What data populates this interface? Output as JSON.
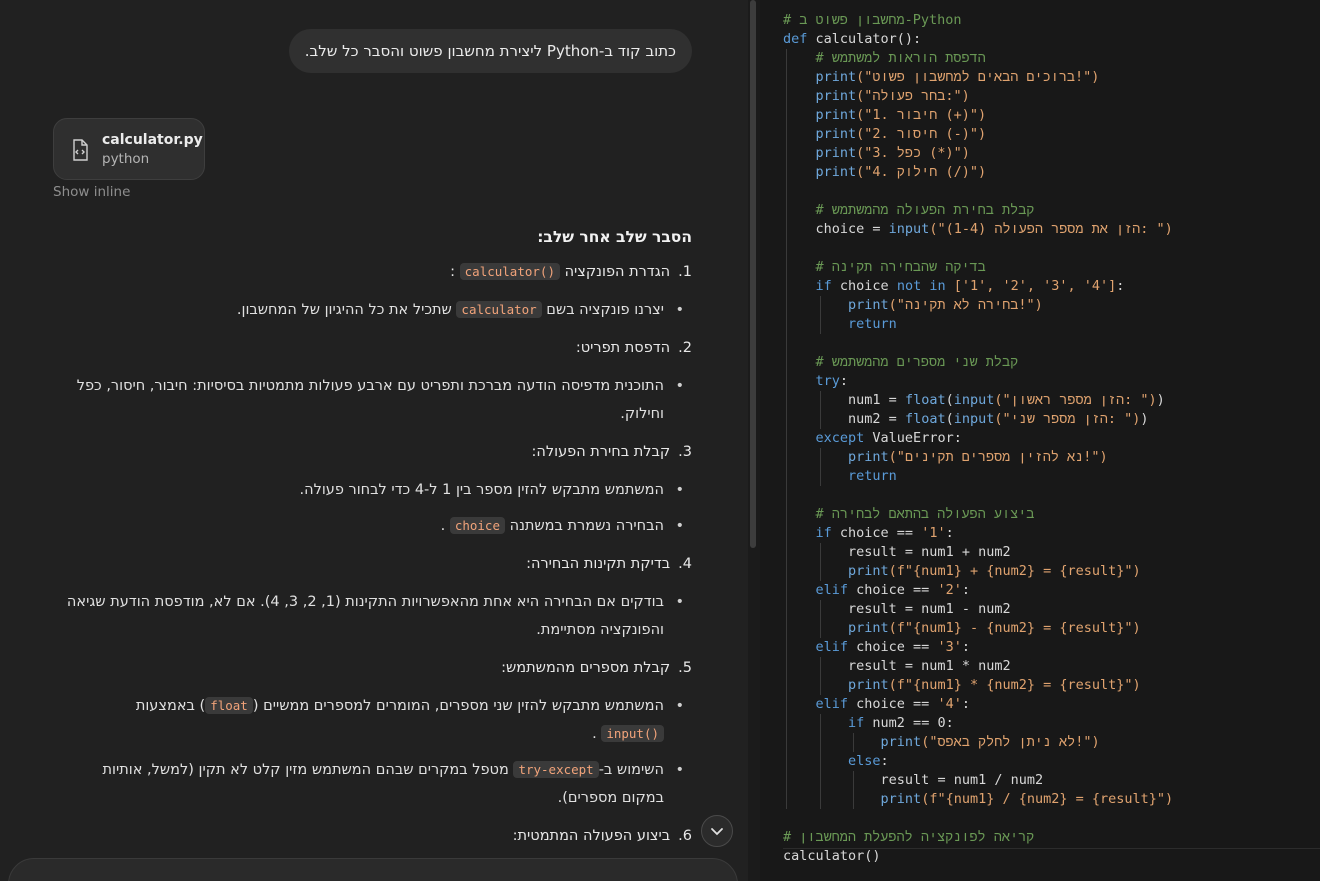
{
  "chat": {
    "user_message": "כתוב קוד ב-Python ליצירת מחשבון פשוט והסבר כל שלב.",
    "file_card": {
      "name": "calculator.py",
      "type": "python",
      "icon": "code-file-icon"
    },
    "show_inline": "Show inline",
    "title": "הסבר שלב אחר שלב:",
    "steps": [
      {
        "num": "1.",
        "label": "הגדרת הפונקציה",
        "code": "calculator()",
        "suffix": ":"
      },
      {
        "num": "2.",
        "label": "הדפסת תפריט:"
      },
      {
        "num": "3.",
        "label": "קבלת בחירת הפעולה:"
      },
      {
        "num": "4.",
        "label": "בדיקת תקינות הבחירה:"
      },
      {
        "num": "5.",
        "label": "קבלת מספרים מהמשתמש:"
      },
      {
        "num": "6.",
        "label": "ביצוע הפעולה המתמטית:"
      }
    ],
    "bullets": {
      "b1_pre": "יצרנו פונקציה בשם",
      "b1_code": "calculator",
      "b1_post": "שתכיל את כל ההיגיון של המחשבון.",
      "b2_line1": "התוכנית מדפיסה הודעה מברכת ותפריט עם ארבע פעולות מתמטיות בסיסיות: חיבור, חיסור, כפל",
      "b2_line2": "וחילוק.",
      "b3": "המשתמש מתבקש להזין מספר בין 1 ל-4 כדי לבחור פעולה.",
      "b4_pre": "הבחירה נשמרת במשתנה",
      "b4_code": "choice",
      "b4_post": ".",
      "b5_line1": "בודקים אם הבחירה היא אחת מהאפשרויות התקינות (1, 2, 3, 4). אם לא, מודפסת הודעת שגיאה",
      "b5_line2": "והפונקציה מסתיימת.",
      "b6_pre": "המשתמש מתבקש להזין שני מספרים, המומרים למספרים ממשיים (",
      "b6_code1": "float",
      "b6_mid": ") באמצעות",
      "b6_code2": "input()",
      "b6_post": ".",
      "b7_pre": "השימוש ב-",
      "b7_code": "try-except",
      "b7_post": "מטפל במקרים שבהם המשתמש מזין קלט לא תקין (למשל, אותיות",
      "b7_line2": "במקום מספרים)."
    }
  },
  "code": {
    "lines": [
      {
        "i": 0,
        "t": [
          [
            "cm",
            "# מחשבון פשוט ב-Python"
          ]
        ]
      },
      {
        "i": 0,
        "t": [
          [
            "kw",
            "def "
          ],
          [
            "nm",
            "calculator():"
          ]
        ]
      },
      {
        "i": 1,
        "t": [
          [
            "cm",
            "# הדפסת הוראות למשתמש"
          ]
        ]
      },
      {
        "i": 1,
        "t": [
          [
            "fn",
            "print"
          ],
          [
            "str",
            "(\"ברוכים הבאים למחשבון פשוט!\")"
          ]
        ]
      },
      {
        "i": 1,
        "t": [
          [
            "fn",
            "print"
          ],
          [
            "str",
            "(\"בחר פעולה:\")"
          ]
        ]
      },
      {
        "i": 1,
        "t": [
          [
            "fn",
            "print"
          ],
          [
            "str",
            "(\"1. חיבור (+)\")"
          ]
        ]
      },
      {
        "i": 1,
        "t": [
          [
            "fn",
            "print"
          ],
          [
            "str",
            "(\"2. חיסור (-)\")"
          ]
        ]
      },
      {
        "i": 1,
        "t": [
          [
            "fn",
            "print"
          ],
          [
            "str",
            "(\"3. כפל (*)\")"
          ]
        ]
      },
      {
        "i": 1,
        "t": [
          [
            "fn",
            "print"
          ],
          [
            "str",
            "(\"4. חילוק (/)\")"
          ]
        ]
      },
      {
        "i": 1,
        "t": []
      },
      {
        "i": 1,
        "t": [
          [
            "cm",
            "# קבלת בחירת הפעולה מהמשתמש"
          ]
        ]
      },
      {
        "i": 1,
        "t": [
          [
            "nm",
            "choice = "
          ],
          [
            "fn",
            "input"
          ],
          [
            "str",
            "(\"הזן את מספר הפעולה (1-4): \")"
          ]
        ]
      },
      {
        "i": 1,
        "t": []
      },
      {
        "i": 1,
        "t": [
          [
            "cm",
            "# בדיקה שהבחירה תקינה"
          ]
        ]
      },
      {
        "i": 1,
        "t": [
          [
            "kw",
            "if "
          ],
          [
            "nm",
            "choice "
          ],
          [
            "kw",
            "not in "
          ],
          [
            "str",
            "['1', '2', '3', '4']"
          ],
          [
            "nm",
            ":"
          ]
        ]
      },
      {
        "i": 2,
        "t": [
          [
            "fn",
            "print"
          ],
          [
            "str",
            "(\"בחירה לא תקינה!\")"
          ]
        ]
      },
      {
        "i": 2,
        "t": [
          [
            "kw",
            "return"
          ]
        ]
      },
      {
        "i": 1,
        "t": []
      },
      {
        "i": 1,
        "t": [
          [
            "cm",
            "# קבלת שני מספרים מהמשתמש"
          ]
        ]
      },
      {
        "i": 1,
        "t": [
          [
            "kw",
            "try"
          ],
          [
            "nm",
            ":"
          ]
        ]
      },
      {
        "i": 2,
        "t": [
          [
            "nm",
            "num1 = "
          ],
          [
            "fn",
            "float"
          ],
          [
            "nm",
            "("
          ],
          [
            "fn",
            "input"
          ],
          [
            "str",
            "(\"הזן מספר ראשון: \")"
          ],
          [
            "nm",
            ")"
          ]
        ]
      },
      {
        "i": 2,
        "t": [
          [
            "nm",
            "num2 = "
          ],
          [
            "fn",
            "float"
          ],
          [
            "nm",
            "("
          ],
          [
            "fn",
            "input"
          ],
          [
            "str",
            "(\"הזן מספר שני: \")"
          ],
          [
            "nm",
            ")"
          ]
        ]
      },
      {
        "i": 1,
        "t": [
          [
            "kw",
            "except "
          ],
          [
            "nm",
            "ValueError:"
          ]
        ]
      },
      {
        "i": 2,
        "t": [
          [
            "fn",
            "print"
          ],
          [
            "str",
            "(\"נא להזין מספרים תקינים!\")"
          ]
        ]
      },
      {
        "i": 2,
        "t": [
          [
            "kw",
            "return"
          ]
        ]
      },
      {
        "i": 1,
        "t": []
      },
      {
        "i": 1,
        "t": [
          [
            "cm",
            "# ביצוע הפעולה בהתאם לבחירה"
          ]
        ]
      },
      {
        "i": 1,
        "t": [
          [
            "kw",
            "if "
          ],
          [
            "nm",
            "choice == "
          ],
          [
            "str",
            "'1'"
          ],
          [
            "nm",
            ":"
          ]
        ]
      },
      {
        "i": 2,
        "t": [
          [
            "nm",
            "result = num1 + num2"
          ]
        ]
      },
      {
        "i": 2,
        "t": [
          [
            "fn",
            "print"
          ],
          [
            "str",
            "(f\"{num1} + {num2} = {result}\")"
          ]
        ]
      },
      {
        "i": 1,
        "t": [
          [
            "kw",
            "elif "
          ],
          [
            "nm",
            "choice == "
          ],
          [
            "str",
            "'2'"
          ],
          [
            "nm",
            ":"
          ]
        ]
      },
      {
        "i": 2,
        "t": [
          [
            "nm",
            "result = num1 - num2"
          ]
        ]
      },
      {
        "i": 2,
        "t": [
          [
            "fn",
            "print"
          ],
          [
            "str",
            "(f\"{num1} - {num2} = {result}\")"
          ]
        ]
      },
      {
        "i": 1,
        "t": [
          [
            "kw",
            "elif "
          ],
          [
            "nm",
            "choice == "
          ],
          [
            "str",
            "'3'"
          ],
          [
            "nm",
            ":"
          ]
        ]
      },
      {
        "i": 2,
        "t": [
          [
            "nm",
            "result = num1 * num2"
          ]
        ]
      },
      {
        "i": 2,
        "t": [
          [
            "fn",
            "print"
          ],
          [
            "str",
            "(f\"{num1} * {num2} = {result}\")"
          ]
        ]
      },
      {
        "i": 1,
        "t": [
          [
            "kw",
            "elif "
          ],
          [
            "nm",
            "choice == "
          ],
          [
            "str",
            "'4'"
          ],
          [
            "nm",
            ":"
          ]
        ]
      },
      {
        "i": 2,
        "t": [
          [
            "kw",
            "if "
          ],
          [
            "nm",
            "num2 == 0:"
          ]
        ]
      },
      {
        "i": 3,
        "t": [
          [
            "fn",
            "print"
          ],
          [
            "str",
            "(\"לא ניתן לחלק באפס!\")"
          ]
        ]
      },
      {
        "i": 2,
        "t": [
          [
            "kw",
            "else"
          ],
          [
            "nm",
            ":"
          ]
        ]
      },
      {
        "i": 3,
        "t": [
          [
            "nm",
            "result = num1 / num2"
          ]
        ]
      },
      {
        "i": 3,
        "t": [
          [
            "fn",
            "print"
          ],
          [
            "str",
            "(f\"{num1} / {num2} = {result}\")"
          ]
        ]
      },
      {
        "i": 0,
        "t": []
      },
      {
        "i": 0,
        "t": [
          [
            "cm",
            "# קריאה לפונקציה להפעלת המחשבון"
          ]
        ]
      },
      {
        "i": 0,
        "t": [
          [
            "nm",
            "calculator()"
          ]
        ]
      }
    ]
  }
}
